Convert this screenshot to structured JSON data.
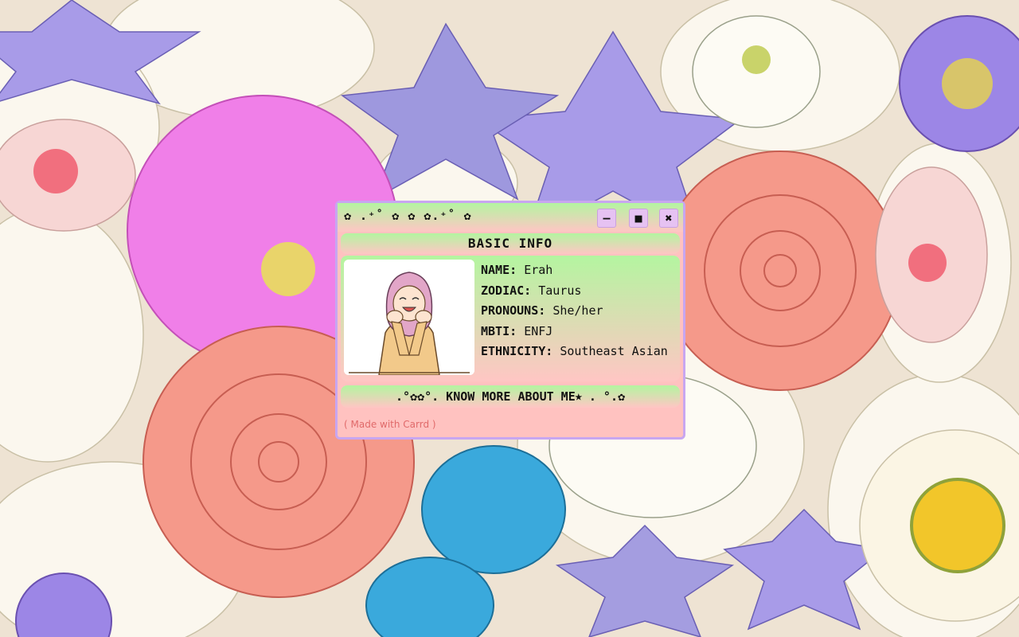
{
  "window": {
    "title": "✿ .⁺˚ ✿ ✿ ✿.⁺˚ ✿",
    "minimize_label": "–",
    "maximize_label": "■",
    "close_label": "✖"
  },
  "profile": {
    "section_title": "BASIC INFO",
    "fields": [
      {
        "key": "NAME:",
        "value": "Erah"
      },
      {
        "key": "ZODIAC:",
        "value": "Taurus"
      },
      {
        "key": "PRONOUNS:",
        "value": "She/her"
      },
      {
        "key": "MBTI:",
        "value": "ENFJ"
      },
      {
        "key": "ETHNICITY:",
        "value": "Southeast Asian"
      }
    ],
    "more_link": ".°✿✿°. KNOW MORE ABOUT ME⭑ . °.✿"
  },
  "footer": {
    "made_with": "( Made with Carrd )"
  },
  "colors": {
    "window_bg": "#ffc2c0",
    "window_border": "#c8a6f0",
    "gradient_top": "#b4f5a0",
    "gradient_bottom": "#ffc6c4",
    "button_bg": "#e6c2f2",
    "footer_text": "#e06a6a"
  }
}
